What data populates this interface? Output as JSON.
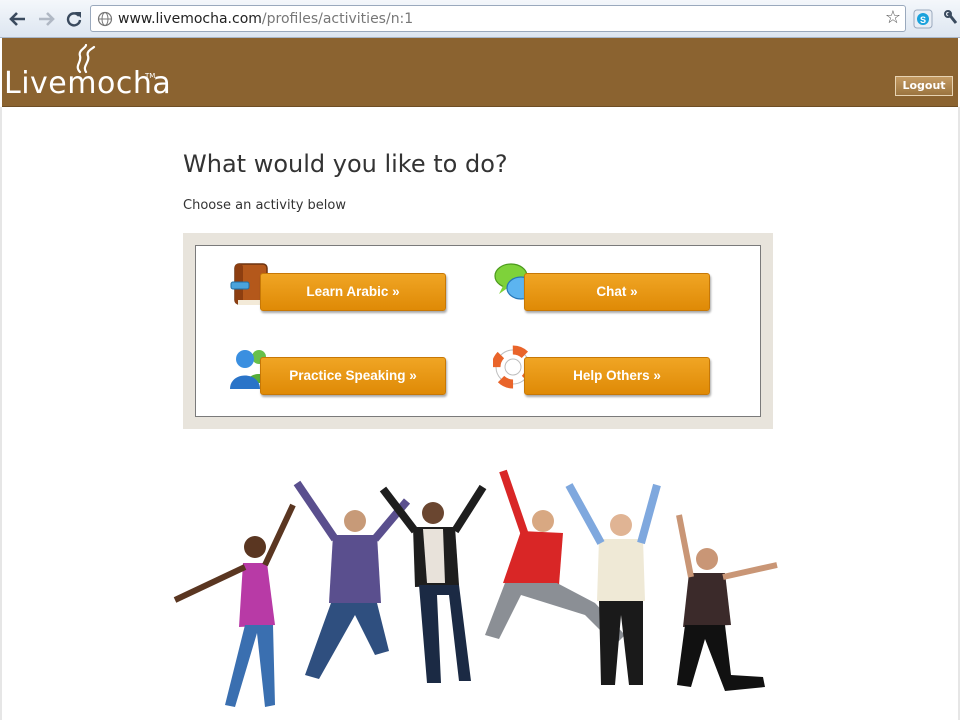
{
  "browser": {
    "url_host": "www.livemocha.com",
    "url_path": "/profiles/activities/n:1"
  },
  "header": {
    "logo": "Livemocha",
    "logo_tm": "TM",
    "logout_label": "Logout",
    "bg_color": "#8b6330"
  },
  "main": {
    "title": "What would you like to do?",
    "subtitle": "Choose an activity below",
    "activities": [
      {
        "label": "Learn Arabic »",
        "icon": "book-icon"
      },
      {
        "label": "Chat »",
        "icon": "chat-bubbles-icon"
      },
      {
        "label": "Practice Speaking »",
        "icon": "people-icon"
      },
      {
        "label": "Help Others »",
        "icon": "life-ring-icon"
      }
    ],
    "accent_color": "#e8960f"
  }
}
